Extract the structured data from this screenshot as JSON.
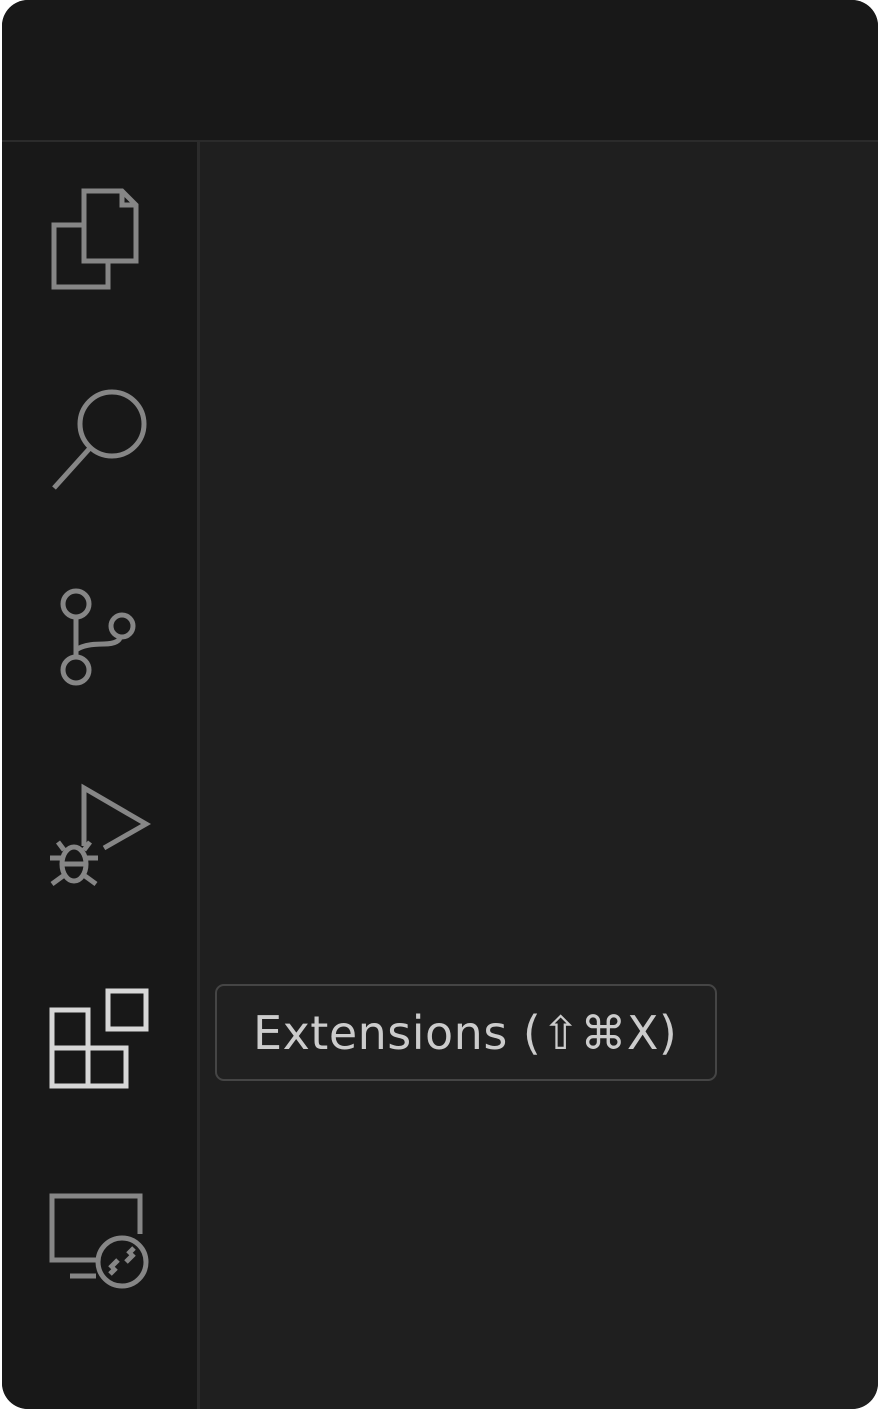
{
  "activity_bar": {
    "items": [
      {
        "id": "explorer",
        "icon": "files-icon",
        "active": false
      },
      {
        "id": "search",
        "icon": "search-icon",
        "active": false
      },
      {
        "id": "source-control",
        "icon": "source-control-icon",
        "active": false
      },
      {
        "id": "run-debug",
        "icon": "run-debug-icon",
        "active": false
      },
      {
        "id": "extensions",
        "icon": "extensions-icon",
        "active": true
      },
      {
        "id": "remote-explorer",
        "icon": "remote-explorer-icon",
        "active": false
      }
    ]
  },
  "tooltip": {
    "text": "Extensions (⇧⌘X)"
  },
  "colors": {
    "titlebar_bg": "#181818",
    "activity_bar_bg": "#181818",
    "editor_bg": "#1f1f1f",
    "icon_inactive": "#868686",
    "icon_active": "#d7d7d7",
    "tooltip_border": "#454545",
    "tooltip_text": "#cccccc"
  }
}
